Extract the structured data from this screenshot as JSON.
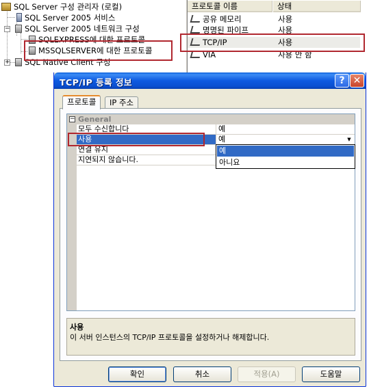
{
  "tree": {
    "root": "SQL Server 구성 관리자 (로컬)",
    "services": "SQL Server 2005 서비스",
    "network_config": "SQL Server 2005 네트워크 구성",
    "sqlexpress_protocols": "SQLEXPRESS에 대한 프로토콜",
    "mssqlserver_protocols": "MSSQLSERVER에 대한 프로토콜",
    "native_client": "SQL Native Client 구성"
  },
  "protocol_list": {
    "columns": [
      "프로토콜 이름",
      "상태"
    ],
    "rows": [
      {
        "name": "공유 메모리",
        "state": "사용"
      },
      {
        "name": "명명된 파이프",
        "state": "사용"
      },
      {
        "name": "TCP/IP",
        "state": "사용"
      },
      {
        "name": "VIA",
        "state": "사용 안 함"
      }
    ]
  },
  "dialog": {
    "title": "TCP/IP 등록 정보",
    "help_glyph": "?",
    "close_glyph": "✕",
    "tabs": [
      "프로토콜",
      "IP 주소"
    ],
    "category": "General",
    "properties": [
      {
        "name": "모두 수신합니다",
        "value": "예"
      },
      {
        "name": "사용",
        "value": "예"
      },
      {
        "name": "연결 유지",
        "value": ""
      },
      {
        "name": "지연되지 않습니다.",
        "value": ""
      }
    ],
    "dropdown_options": [
      "예",
      "아니요"
    ],
    "description_title": "사용",
    "description_text": "이 서버 인스턴스의 TCP/IP 프로토콜을 설정하거나 해제합니다.",
    "buttons": {
      "ok": "확인",
      "cancel": "취소",
      "apply": "적용(A)",
      "help": "도움말"
    }
  },
  "colors": {
    "highlight_box": "#b0262e",
    "selection": "#316ac5",
    "title_bar": "#0a5fdc"
  }
}
